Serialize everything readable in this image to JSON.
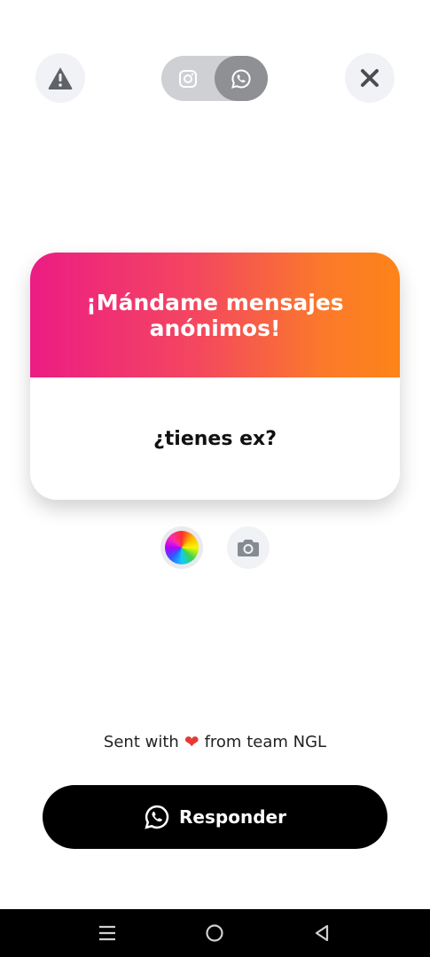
{
  "header": {
    "report_icon": "warning-triangle-icon",
    "close_icon": "close-x-icon",
    "share_options": [
      {
        "name": "instagram",
        "icon": "instagram-icon",
        "selected": false
      },
      {
        "name": "whatsapp",
        "icon": "whatsapp-icon",
        "selected": true
      }
    ]
  },
  "card": {
    "title": "¡Mándame mensajes anónimos!",
    "question": "¿tienes ex?",
    "gradient_colors": [
      "#ec1c84",
      "#fd8418"
    ]
  },
  "tools": {
    "color_icon": "color-wheel-icon",
    "camera_icon": "camera-icon"
  },
  "footer": {
    "sent_prefix": "Sent with",
    "sent_suffix": "from team NGL",
    "reply_label": "Responder",
    "reply_icon": "whatsapp-icon"
  },
  "nav": {
    "menu_icon": "menu-icon",
    "home_icon": "home-icon",
    "back_icon": "back-icon"
  }
}
